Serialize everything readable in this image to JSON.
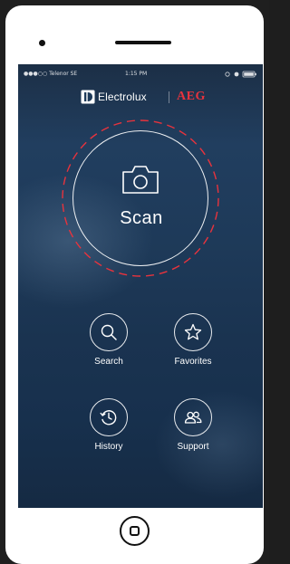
{
  "status_bar": {
    "carrier": "●●●○○ Telenor SE",
    "time": "1:15 PM"
  },
  "brand": {
    "electrolux": "Electrolux",
    "aeg": "AEG",
    "aeg_color": "#e8333d"
  },
  "scan": {
    "label": "Scan",
    "icon": "camera-icon",
    "ring_color": "#e8333d"
  },
  "actions": [
    {
      "label": "Search",
      "icon": "search-icon"
    },
    {
      "label": "Favorites",
      "icon": "star-icon"
    },
    {
      "label": "History",
      "icon": "history-icon"
    },
    {
      "label": "Support",
      "icon": "support-icon"
    }
  ],
  "colors": {
    "screen_background": "#1e3a59",
    "device_body": "#ffffff"
  }
}
